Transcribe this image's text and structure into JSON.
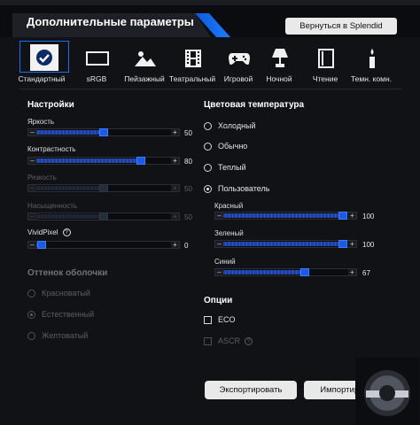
{
  "header": {
    "title": "Дополнительные параметры",
    "back_button": "Вернуться в Splendid"
  },
  "presets": [
    {
      "label": "Стандартный",
      "icon": "check-circle-icon",
      "selected": true
    },
    {
      "label": "sRGB",
      "icon": "monitor-icon",
      "selected": false
    },
    {
      "label": "Пейзажный",
      "icon": "mountain-icon",
      "selected": false
    },
    {
      "label": "Театральный",
      "icon": "film-icon",
      "selected": false
    },
    {
      "label": "Игровой",
      "icon": "gamepad-icon",
      "selected": false
    },
    {
      "label": "Ночной",
      "icon": "lamp-icon",
      "selected": false
    },
    {
      "label": "Чтение",
      "icon": "book-icon",
      "selected": false
    },
    {
      "label": "Темн. комн.",
      "icon": "candle-icon",
      "selected": false
    }
  ],
  "settings": {
    "title": "Настройки",
    "sliders": [
      {
        "label": "Яркость",
        "value": "50",
        "fraction": 0.5,
        "enabled": true
      },
      {
        "label": "Контрастность",
        "value": "80",
        "fraction": 0.8,
        "enabled": true
      },
      {
        "label": "Резкость",
        "value": "50",
        "fraction": 0.5,
        "enabled": false
      },
      {
        "label": "Насыщенность",
        "value": "50",
        "fraction": 0.5,
        "enabled": false
      },
      {
        "label": "VividPixel",
        "value": "0",
        "fraction": 0.0,
        "enabled": true,
        "info": "?"
      }
    ]
  },
  "skin_tone": {
    "title": "Оттенок оболочки",
    "options": [
      {
        "label": "Красноватый",
        "checked": false
      },
      {
        "label": "Естественный",
        "checked": true
      },
      {
        "label": "Желтоватый",
        "checked": false
      }
    ]
  },
  "color_temp": {
    "title": "Цветовая температура",
    "options": [
      {
        "label": "Холодный",
        "checked": false
      },
      {
        "label": "Обычно",
        "checked": false
      },
      {
        "label": "Теплый",
        "checked": false
      },
      {
        "label": "Пользователь",
        "checked": true
      }
    ],
    "rgb": [
      {
        "label": "Красный",
        "value": "100",
        "fraction": 1.0
      },
      {
        "label": "Зеленый",
        "value": "100",
        "fraction": 1.0
      },
      {
        "label": "Синий",
        "value": "67",
        "fraction": 0.67
      }
    ]
  },
  "options": {
    "title": "Опции",
    "eco": "ECO",
    "ascr": "ASCR",
    "info": "?"
  },
  "actions": {
    "export": "Экспортировать",
    "import": "Импортировать"
  },
  "slider_glyphs": {
    "minus": "–",
    "plus": "+"
  },
  "colors": {
    "accent": "#1d6ef5",
    "background": "#101215"
  }
}
